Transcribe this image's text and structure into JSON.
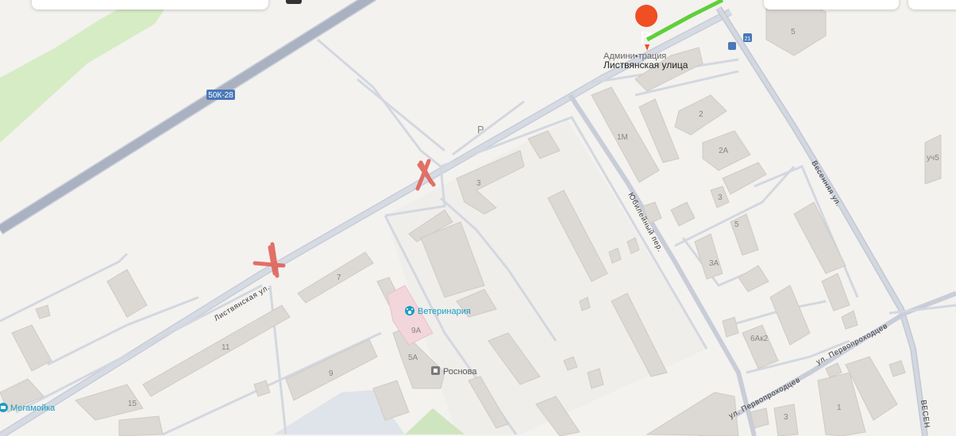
{
  "map": {
    "highway_shield": "50К-28",
    "parking_label": "P",
    "destination": {
      "name": "Листвянская улица",
      "note": "Админи▪трация",
      "pin_icon": "flag-pin-icon",
      "pin_color": "#f04e23"
    },
    "streets": {
      "listvyanskaya": "Листвянская ул.",
      "yubileyny": "Юбилейный пер.",
      "vesennyaya": "Весенняя ул.",
      "vesennyaya_edge": "ВЕСЕН",
      "pervoprokhodtsev_1": "ул. Первопроходцев",
      "pervoprokhodtsev_2": "ул. Первопроходцев"
    },
    "pois": [
      {
        "name": "Ветеринария",
        "icon": "paw-icon",
        "color": "#1a9ec2"
      },
      {
        "name": "Мегамойка",
        "icon": "car-wash-icon",
        "color": "#1a9ec2"
      },
      {
        "name": "Роснова",
        "icon": "office-icon",
        "color": "#555555"
      }
    ],
    "house_numbers": [
      "5",
      "2",
      "2А",
      "1М",
      "3",
      "3",
      "5",
      "3А",
      "6Ак2",
      "7",
      "9А",
      "5А",
      "11",
      "9",
      "15",
      "3",
      "1",
      "уч5"
    ],
    "route_color": "#5fcf3b",
    "markers": [
      {
        "name": "cross-mark-1",
        "color": "#e05a50"
      },
      {
        "name": "cross-mark-2",
        "color": "#e05a50"
      }
    ],
    "small_badge": "21"
  }
}
